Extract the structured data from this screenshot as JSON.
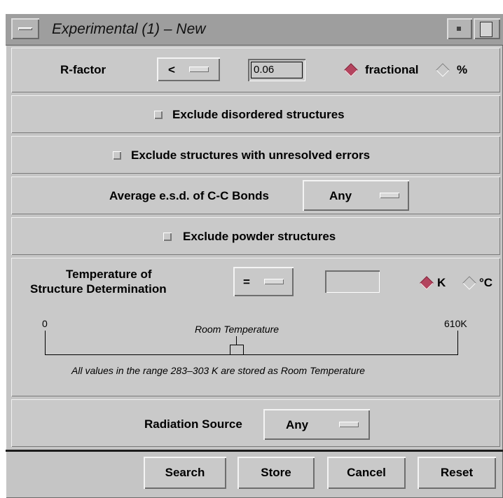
{
  "window": {
    "title": "Experimental (1) – New"
  },
  "rfactor": {
    "label": "R-factor",
    "operator": "<",
    "value": "0.06",
    "unit_options": [
      {
        "label": "fractional",
        "selected": true
      },
      {
        "label": "%",
        "selected": false
      }
    ]
  },
  "exclude_disordered": {
    "label": "Exclude disordered structures",
    "checked": false
  },
  "exclude_errors": {
    "label": "Exclude structures with unresolved errors",
    "checked": false
  },
  "esd": {
    "label": "Average e.s.d. of C-C Bonds",
    "value": "Any"
  },
  "exclude_powder": {
    "label": "Exclude powder structures",
    "checked": false
  },
  "temperature": {
    "label_line1": "Temperature of",
    "label_line2": "Structure Determination",
    "operator": "=",
    "value": "",
    "unit_options": [
      {
        "label": "K",
        "selected": true
      },
      {
        "label": "°C",
        "selected": false
      }
    ],
    "scale": {
      "min_label": "0",
      "max_label": "610K",
      "marker_label": "Room Temperature",
      "note": "All values in the range 283–303 K are stored as Room Temperature"
    }
  },
  "radiation": {
    "label": "Radiation Source",
    "value": "Any"
  },
  "buttons": {
    "search": "Search",
    "store": "Store",
    "cancel": "Cancel",
    "reset": "Reset"
  },
  "colors": {
    "background": "#c9c9c9",
    "radio_selected": "#b3445e",
    "titlebar": "#9e9e9e"
  }
}
